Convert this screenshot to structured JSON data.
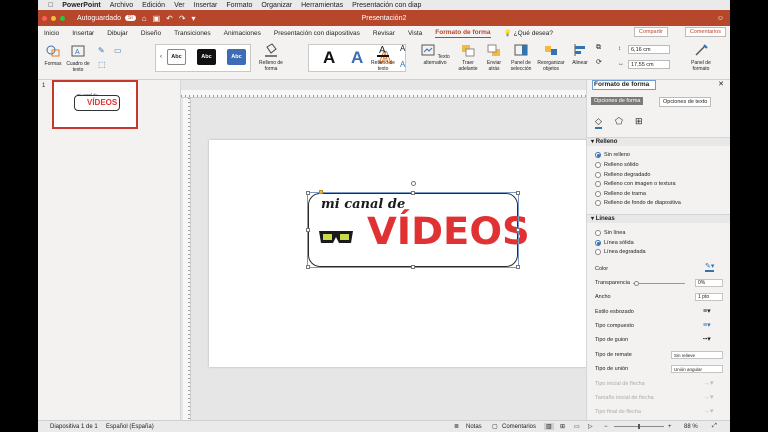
{
  "mac_menu": {
    "app": "PowerPoint",
    "items": [
      "Archivo",
      "Edición",
      "Ver",
      "Insertar",
      "Formato",
      "Organizar",
      "Herramientas",
      "Presentación con diap"
    ]
  },
  "titlebar": {
    "autosave_label": "Autoguardado",
    "autosave_state": "Sí",
    "doc_title": "Presentación2",
    "colors": {
      "bar": "#b7472a"
    }
  },
  "tabs": [
    "Inicio",
    "Insertar",
    "Dibujar",
    "Diseño",
    "Transiciones",
    "Animaciones",
    "Presentación con diapositivas",
    "Revisar",
    "Vista",
    "Formato de forma"
  ],
  "active_tab": "Formato de forma",
  "search_label": "¿Qué desea?",
  "share_label": "Compartir",
  "comments_label": "Comentarios",
  "ribbon": {
    "formas": "Formas",
    "cuadro": "Cuadro de texto",
    "styles": [
      "Abc",
      "Abc",
      "Abc"
    ],
    "relleno": "Relleno de forma",
    "relleno_texto": "Relleno de texto",
    "texto_alt": "Texto alternativo",
    "traer": "Traer adelante",
    "enviar": "Enviar atrás",
    "panel_sel": "Panel de selección",
    "reorg": "Reorganizar objetos",
    "alinear": "Alinear",
    "alto": "6,16 cm",
    "ancho": "17,55 cm",
    "panel_formato": "Panel de formato",
    "wordart": [
      "A",
      "A",
      "A"
    ]
  },
  "slides": {
    "number": "1"
  },
  "logo": {
    "line1": "mi canal de",
    "line2": "VÍDEOS"
  },
  "pane": {
    "title": "Formato de forma",
    "tab1": "Opciones de forma",
    "tab2": "Opciones de texto",
    "relleno_header": "Relleno",
    "relleno_options": [
      "Sin relleno",
      "Relleno sólido",
      "Relleno degradado",
      "Relleno con imagen o textura",
      "Relleno de trama",
      "Relleno de fondo de diapositiva"
    ],
    "lineas_header": "Líneas",
    "lineas_options": [
      "Sin línea",
      "Línea sólida",
      "Línea degradada"
    ],
    "color": "Color",
    "transparencia": "Transparencia",
    "transparencia_val": "0%",
    "ancho": "Ancho",
    "ancho_val": "1 pto",
    "estilo": "Estilo esbozado",
    "compuesto": "Tipo compuesto",
    "guion": "Tipo de guion",
    "remate": "Tipo de remate",
    "remate_val": "Sin relieve",
    "union": "Tipo de unión",
    "union_val": "Unión angular",
    "flecha_ini": "Tipo inicial de flecha",
    "tam_ini": "Tamaño inicial de flecha",
    "flecha_fin": "Tipo final de flecha"
  },
  "status": {
    "slide": "Diapositiva 1 de 1",
    "lang": "Español (España)",
    "notas": "Notas",
    "comentarios": "Comentarios",
    "zoom": "88 %"
  }
}
